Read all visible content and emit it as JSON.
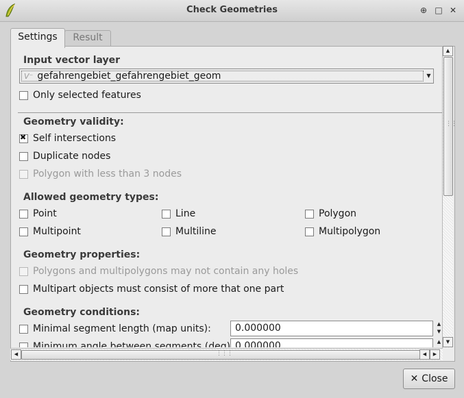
{
  "window": {
    "title": "Check Geometries",
    "controls": {
      "help": "⊕",
      "maximize": "□",
      "close": "✕"
    }
  },
  "tabs": [
    {
      "label": "Settings",
      "active": true
    },
    {
      "label": "Result",
      "active": false
    }
  ],
  "input_layer": {
    "heading": "Input vector layer",
    "layer_icon": "V⁻",
    "selected_layer": "gefahrengebiet_gefahrengebiet_geom",
    "only_selected_label": "Only selected features",
    "only_selected_checked": false
  },
  "geometry_validity": {
    "heading": "Geometry validity:",
    "options": [
      {
        "label": "Self intersections",
        "checked": true,
        "enabled": true
      },
      {
        "label": "Duplicate nodes",
        "checked": false,
        "enabled": true
      },
      {
        "label": "Polygon with less than 3 nodes",
        "checked": false,
        "enabled": false
      }
    ]
  },
  "allowed_types": {
    "heading": "Allowed geometry types:",
    "options": [
      {
        "label": "Point",
        "checked": false
      },
      {
        "label": "Line",
        "checked": false
      },
      {
        "label": "Polygon",
        "checked": false
      },
      {
        "label": "Multipoint",
        "checked": false
      },
      {
        "label": "Multiline",
        "checked": false
      },
      {
        "label": "Multipolygon",
        "checked": false
      }
    ]
  },
  "geometry_properties": {
    "heading": "Geometry properties:",
    "options": [
      {
        "label": "Polygons and multipolygons may not contain any holes",
        "checked": false,
        "enabled": false
      },
      {
        "label": "Multipart objects must consist of more that one part",
        "checked": false,
        "enabled": true
      }
    ]
  },
  "geometry_conditions": {
    "heading": "Geometry conditions:",
    "options": [
      {
        "label": "Minimal segment length (map units):",
        "checked": false,
        "value": "0.000000"
      },
      {
        "label": "Minimum angle between segments (deg):",
        "checked": false,
        "value": "0.000000"
      }
    ]
  },
  "buttons": {
    "close_label": "Close"
  },
  "colors": {
    "background": "#d4d4d4",
    "panel": "#ececec",
    "disabled_text": "#9a9a9a"
  }
}
